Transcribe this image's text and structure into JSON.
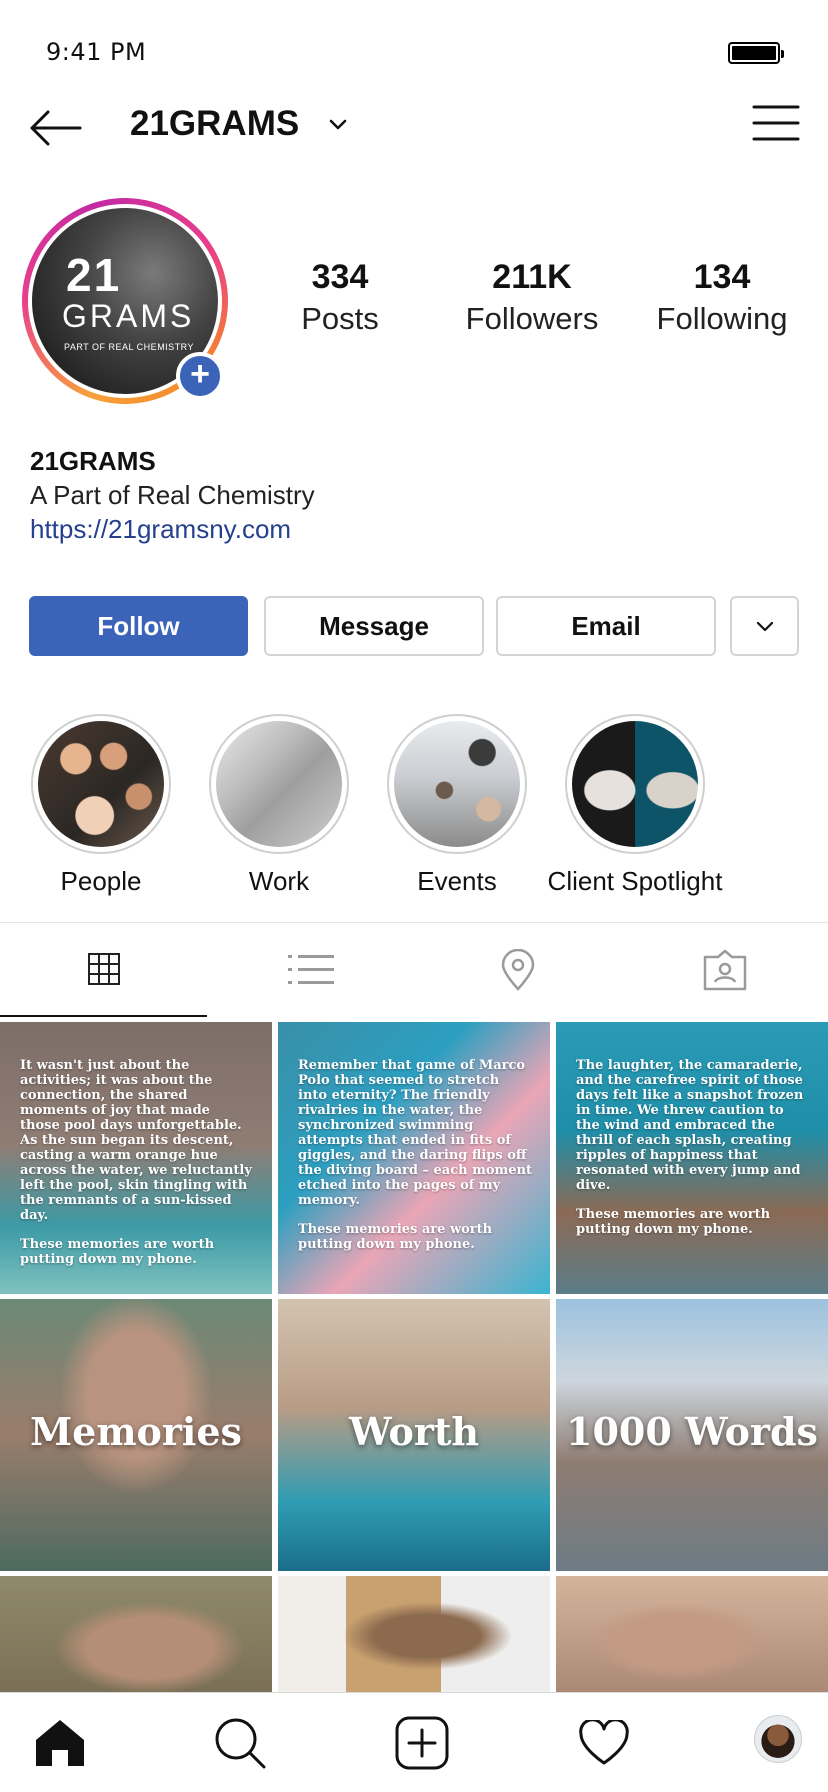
{
  "status_bar": {
    "time": "9:41 PM"
  },
  "header": {
    "username": "21GRAMS"
  },
  "avatar": {
    "logo_number": "21",
    "logo_word": "GRAMS",
    "logo_tagline": "PART OF REAL CHEMISTRY"
  },
  "stats": {
    "posts": {
      "value": "334",
      "label": "Posts"
    },
    "followers": {
      "value": "211K",
      "label": "Followers"
    },
    "following": {
      "value": "134",
      "label": "Following"
    }
  },
  "bio": {
    "name": "21GRAMS",
    "description": "A Part of Real Chemistry",
    "link": "https://21gramsny.com"
  },
  "actions": {
    "follow": "Follow",
    "message": "Message",
    "email": "Email"
  },
  "highlights": [
    {
      "label": "People"
    },
    {
      "label": "Work"
    },
    {
      "label": "Events"
    },
    {
      "label": "Client Spotlight"
    }
  ],
  "posts": [
    {
      "paragraph": "It wasn't just about the activities; it was about the connection, the shared moments of joy that made those pool days unforgettable. As the sun began its descent, casting a warm orange hue across the water, we reluctantly left the pool, skin tingling with the remnants of a sun-kissed day.",
      "closing": "These memories are worth putting down my phone."
    },
    {
      "paragraph": "Remember that game of Marco Polo that seemed to stretch into eternity? The friendly rivalries in the water, the synchronized swimming attempts that ended in fits of giggles, and the daring flips off the diving board – each moment etched into the pages of my memory.",
      "closing": "These memories are worth putting down my phone."
    },
    {
      "paragraph": "The laughter, the camaraderie, and the carefree spirit of those days felt like a snapshot frozen in time. We threw caution to the wind and embraced the thrill of each splash, creating ripples of happiness that resonated with every jump and dive.",
      "closing": "These memories are worth putting down my phone."
    },
    {
      "word": "Memories"
    },
    {
      "word": "Worth"
    },
    {
      "word": "1000 Words"
    }
  ],
  "colors": {
    "accent_blue": "#3b63b8",
    "link_blue": "#24408e"
  }
}
